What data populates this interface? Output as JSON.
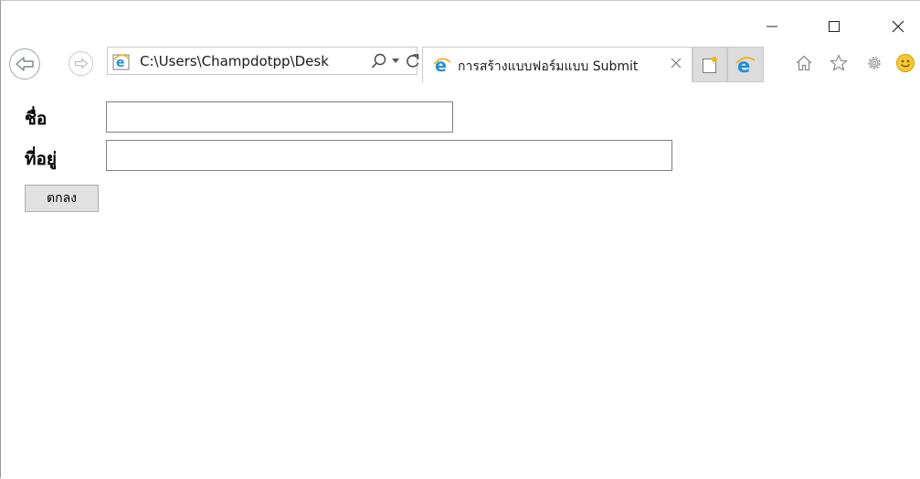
{
  "window": {
    "minimize_icon": "minimize-icon",
    "maximize_icon": "maximize-icon",
    "close_icon": "close-icon"
  },
  "toolbar": {
    "address_url": "C:\\Users\\Champdotpp\\Desk",
    "tab_title": "การสร้างแบบฟอร์มแบบ Submit",
    "accent_color": "#1e8fdc",
    "icons": [
      "back-arrow-icon",
      "forward-arrow-icon",
      "ie-logo-icon",
      "search-icon",
      "dropdown-icon",
      "refresh-icon",
      "tab-close-icon",
      "new-tab-icon",
      "edge-logo-icon",
      "home-icon",
      "star-icon",
      "gear-icon",
      "smiley-icon"
    ]
  },
  "form": {
    "name_label": "ชื่อ",
    "name_value": "",
    "address_label": "ที่อยู่",
    "address_value": "",
    "submit_label": "ตกลง"
  }
}
